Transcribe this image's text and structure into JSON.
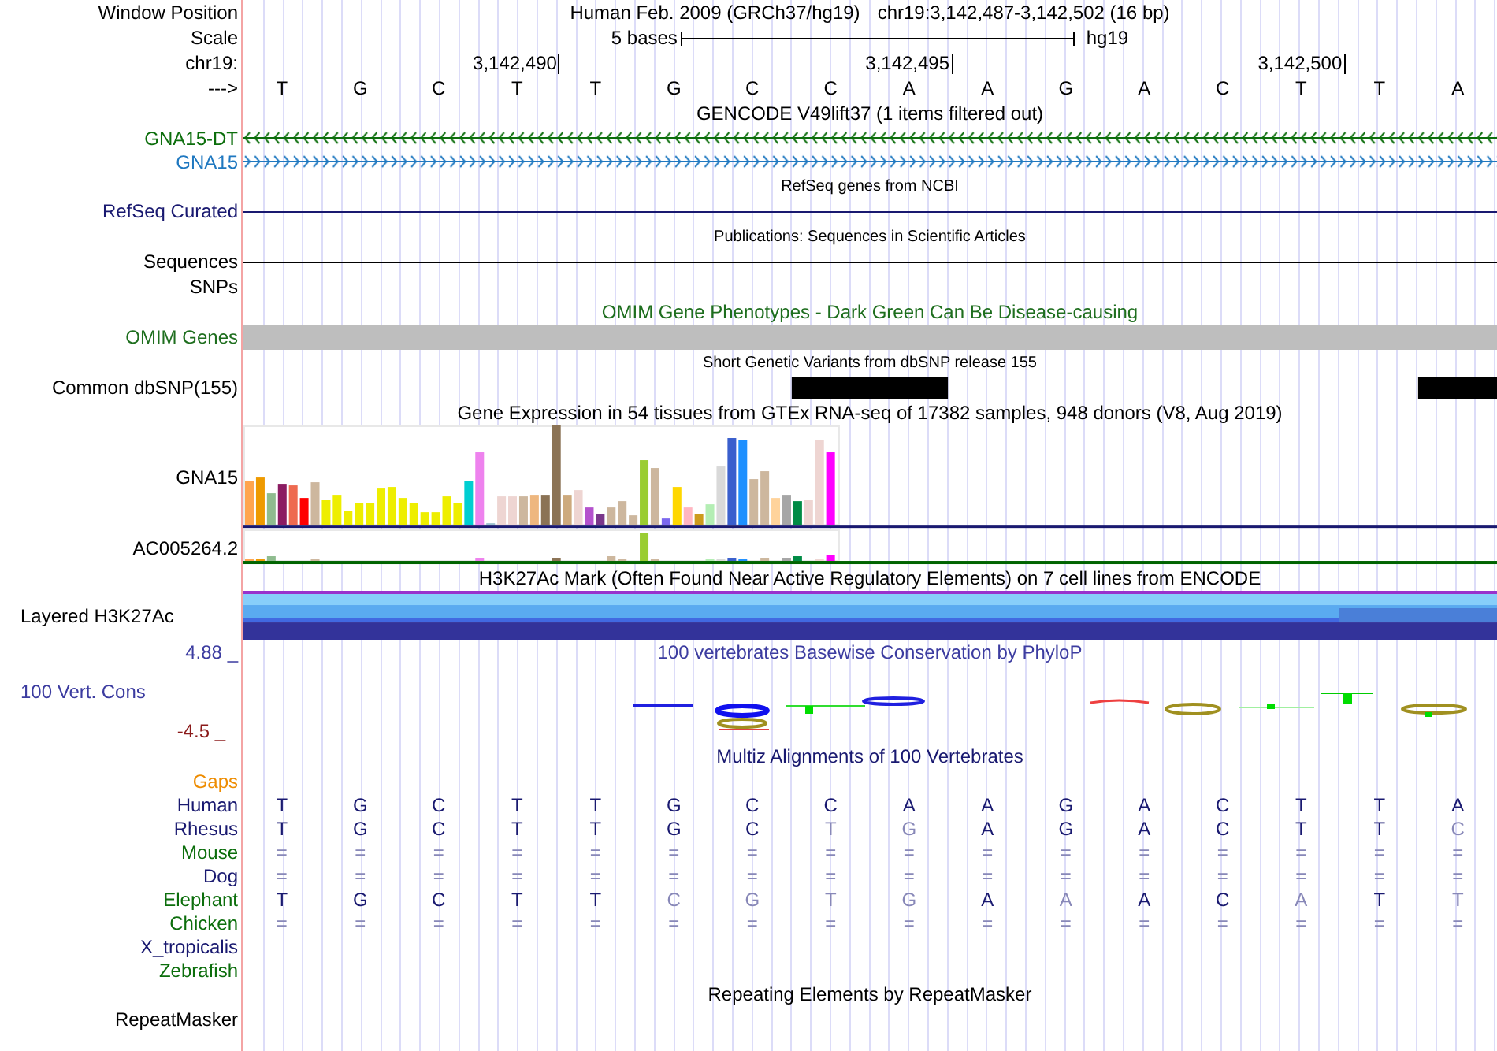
{
  "header": {
    "window_label": "Window Position",
    "assembly_title": "Human Feb. 2009 (GRCh37/hg19)",
    "position": "chr19:3,142,487-3,142,502 (16 bp)",
    "scale_label": "Scale",
    "scale_text": "5 bases",
    "assembly": "hg19",
    "chrom_label": "chr19:",
    "ticks": [
      "3,142,490",
      "3,142,495",
      "3,142,500"
    ],
    "strand_label": "--->",
    "bases": [
      "T",
      "G",
      "C",
      "T",
      "T",
      "G",
      "C",
      "C",
      "A",
      "A",
      "G",
      "A",
      "C",
      "T",
      "T",
      "A"
    ]
  },
  "tracks": [
    {
      "kind": "title",
      "text": "GENCODE V49lift37 (1 items filtered out)",
      "color": "#000000"
    },
    {
      "kind": "gene",
      "label": "GNA15-DT",
      "color": "#0c6e0c",
      "reverse_strand": true
    },
    {
      "kind": "gene",
      "label": "GNA15",
      "color": "#1f78c0",
      "reverse_strand": false
    },
    {
      "kind": "subtitle",
      "text": "RefSeq genes from NCBI",
      "color": "#000000"
    },
    {
      "kind": "line",
      "label": "RefSeq Curated",
      "color": "#191970"
    },
    {
      "kind": "subtitle",
      "text": "Publications: Sequences in Scientific Articles",
      "color": "#000000"
    },
    {
      "kind": "line",
      "label": "Sequences",
      "color": "#000000"
    },
    {
      "kind": "empty",
      "label": "SNPs",
      "color": "#000000"
    },
    {
      "kind": "title",
      "text": "OMIM Gene Phenotypes - Dark Green Can Be Disease-causing",
      "color": "#1e6e1e"
    },
    {
      "kind": "bar",
      "label": "OMIM Genes",
      "color": "#1e6e1e"
    },
    {
      "kind": "subtitle",
      "text": "Short Genetic Variants from dbSNP release 155",
      "color": "#000000"
    },
    {
      "kind": "snps",
      "label": "Common dbSNP(155)",
      "color": "#000000"
    },
    {
      "kind": "title",
      "text": "Gene Expression in 54 tissues from GTEx RNA-seq of 17382 samples, 948 donors (V8, Aug 2019)",
      "color": "#000000"
    },
    {
      "kind": "expression",
      "label": "GNA15",
      "color": "#000000"
    },
    {
      "kind": "expression_minor",
      "label": "AC005264.2",
      "color": "#000000"
    },
    {
      "kind": "title",
      "text": "H3K27Ac Mark (Often Found Near Active Regulatory Elements) on 7 cell lines from ENCODE",
      "color": "#000000"
    },
    {
      "kind": "layered",
      "label": "Layered H3K27Ac",
      "color": "#000000"
    },
    {
      "kind": "conservation",
      "label": "100 Vert. Cons",
      "max": "4.88 _",
      "min": "-4.5 _",
      "title": "100 vertebrates Basewise Conservation by PhyloP",
      "color": "#3c3ca0"
    },
    {
      "kind": "title",
      "text": "Multiz Alignments of 100 Vertebrates",
      "color": "#191970"
    },
    {
      "kind": "alignment",
      "species": [
        {
          "name": "Gaps",
          "color": "#ee8c00"
        },
        {
          "name": "Human",
          "color": "#191970",
          "bases": [
            {
              "base": "T",
              "faded": false
            },
            {
              "base": "G",
              "faded": false
            },
            {
              "base": "C",
              "faded": false
            },
            {
              "base": "T",
              "faded": false
            },
            {
              "base": "T",
              "faded": false
            },
            {
              "base": "G",
              "faded": false
            },
            {
              "base": "C",
              "faded": false
            },
            {
              "base": "C",
              "faded": false
            },
            {
              "base": "A",
              "faded": false
            },
            {
              "base": "A",
              "faded": false
            },
            {
              "base": "G",
              "faded": false
            },
            {
              "base": "A",
              "faded": false
            },
            {
              "base": "C",
              "faded": false
            },
            {
              "base": "T",
              "faded": false
            },
            {
              "base": "T",
              "faded": false
            },
            {
              "base": "A",
              "faded": false
            }
          ]
        },
        {
          "name": "Rhesus",
          "color": "#191970",
          "bases": [
            {
              "base": "T",
              "faded": false
            },
            {
              "base": "G",
              "faded": false
            },
            {
              "base": "C",
              "faded": false
            },
            {
              "base": "T",
              "faded": false
            },
            {
              "base": "T",
              "faded": false
            },
            {
              "base": "G",
              "faded": false
            },
            {
              "base": "C",
              "faded": false
            },
            {
              "base": "T",
              "faded": true
            },
            {
              "base": "G",
              "faded": true
            },
            {
              "base": "A",
              "faded": false
            },
            {
              "base": "G",
              "faded": false
            },
            {
              "base": "A",
              "faded": false
            },
            {
              "base": "C",
              "faded": false
            },
            {
              "base": "T",
              "faded": false
            },
            {
              "base": "T",
              "faded": false
            },
            {
              "base": "C",
              "faded": true
            }
          ]
        },
        {
          "name": "Mouse",
          "color": "#0c6e0c",
          "bases": [
            {
              "base": "=",
              "faded": true
            },
            {
              "base": "=",
              "faded": true
            },
            {
              "base": "=",
              "faded": true
            },
            {
              "base": "=",
              "faded": true
            },
            {
              "base": "=",
              "faded": true
            },
            {
              "base": "=",
              "faded": true
            },
            {
              "base": "=",
              "faded": true
            },
            {
              "base": "=",
              "faded": true
            },
            {
              "base": "=",
              "faded": true
            },
            {
              "base": "=",
              "faded": true
            },
            {
              "base": "=",
              "faded": true
            },
            {
              "base": "=",
              "faded": true
            },
            {
              "base": "=",
              "faded": true
            },
            {
              "base": "=",
              "faded": true
            },
            {
              "base": "=",
              "faded": true
            },
            {
              "base": "=",
              "faded": true
            }
          ]
        },
        {
          "name": "Dog",
          "color": "#191970",
          "bases": [
            {
              "base": "=",
              "faded": true
            },
            {
              "base": "=",
              "faded": true
            },
            {
              "base": "=",
              "faded": true
            },
            {
              "base": "=",
              "faded": true
            },
            {
              "base": "=",
              "faded": true
            },
            {
              "base": "=",
              "faded": true
            },
            {
              "base": "=",
              "faded": true
            },
            {
              "base": "=",
              "faded": true
            },
            {
              "base": "=",
              "faded": true
            },
            {
              "base": "=",
              "faded": true
            },
            {
              "base": "=",
              "faded": true
            },
            {
              "base": "=",
              "faded": true
            },
            {
              "base": "=",
              "faded": true
            },
            {
              "base": "=",
              "faded": true
            },
            {
              "base": "=",
              "faded": true
            },
            {
              "base": "=",
              "faded": true
            }
          ]
        },
        {
          "name": "Elephant",
          "color": "#0c6e0c",
          "bases": [
            {
              "base": "T",
              "faded": false
            },
            {
              "base": "G",
              "faded": false
            },
            {
              "base": "C",
              "faded": false
            },
            {
              "base": "T",
              "faded": false
            },
            {
              "base": "T",
              "faded": false
            },
            {
              "base": "C",
              "faded": true
            },
            {
              "base": "G",
              "faded": true
            },
            {
              "base": "T",
              "faded": true
            },
            {
              "base": "G",
              "faded": true
            },
            {
              "base": "A",
              "faded": false
            },
            {
              "base": "A",
              "faded": true
            },
            {
              "base": "A",
              "faded": false
            },
            {
              "base": "C",
              "faded": false
            },
            {
              "base": "A",
              "faded": true
            },
            {
              "base": "T",
              "faded": false
            },
            {
              "base": "T",
              "faded": true
            }
          ]
        },
        {
          "name": "Chicken",
          "color": "#0c6e0c",
          "bases": [
            {
              "base": "=",
              "faded": true
            },
            {
              "base": "=",
              "faded": true
            },
            {
              "base": "=",
              "faded": true
            },
            {
              "base": "=",
              "faded": true
            },
            {
              "base": "=",
              "faded": true
            },
            {
              "base": "=",
              "faded": true
            },
            {
              "base": "=",
              "faded": true
            },
            {
              "base": "=",
              "faded": true
            },
            {
              "base": "=",
              "faded": true
            },
            {
              "base": "=",
              "faded": true
            },
            {
              "base": "=",
              "faded": true
            },
            {
              "base": "=",
              "faded": true
            },
            {
              "base": "=",
              "faded": true
            },
            {
              "base": "=",
              "faded": true
            },
            {
              "base": "=",
              "faded": true
            },
            {
              "base": "=",
              "faded": true
            }
          ]
        },
        {
          "name": "X_tropicalis",
          "color": "#191970"
        },
        {
          "name": "Zebrafish",
          "color": "#0c6e0c"
        }
      ]
    },
    {
      "kind": "title",
      "text": "Repeating Elements by RepeatMasker",
      "color": "#000000"
    },
    {
      "kind": "empty",
      "label": "RepeatMasker",
      "color": "#000000"
    }
  ]
}
